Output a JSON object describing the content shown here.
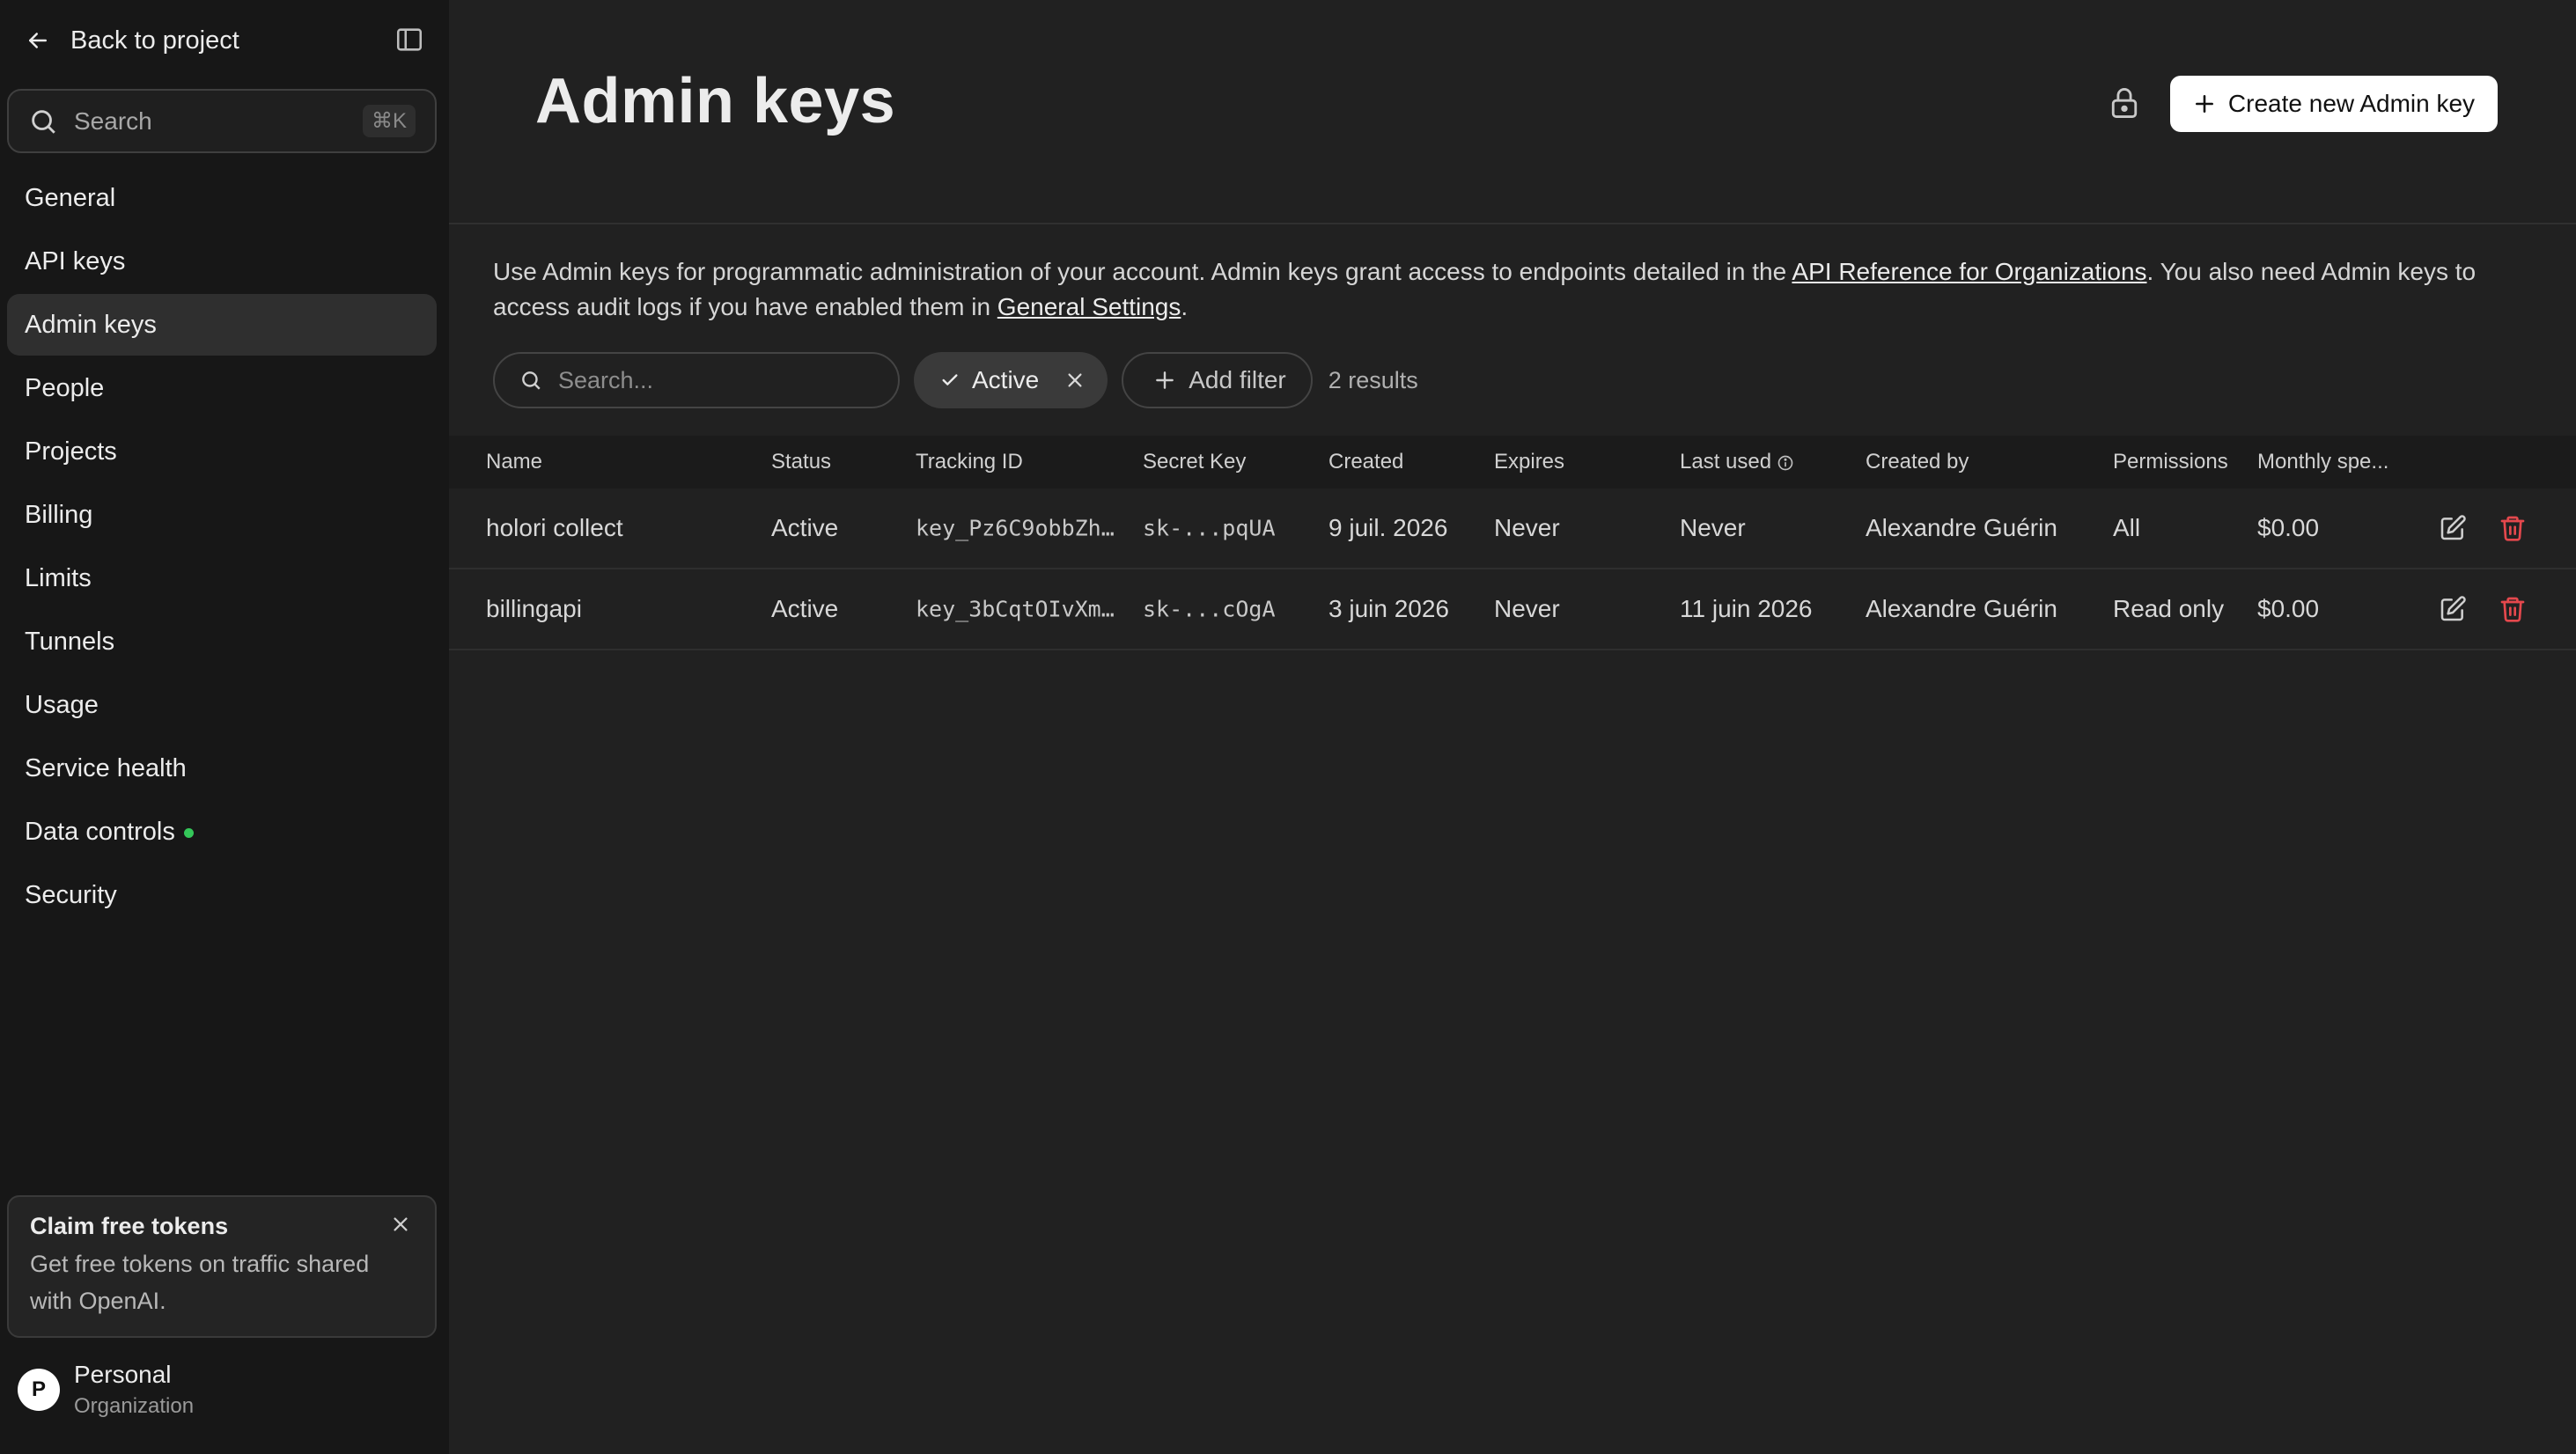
{
  "sidebar": {
    "back_label": "Back to project",
    "search_placeholder": "Search",
    "search_shortcut": "⌘K",
    "nav": [
      {
        "label": "General"
      },
      {
        "label": "API keys"
      },
      {
        "label": "Admin keys",
        "active": true
      },
      {
        "label": "People"
      },
      {
        "label": "Projects"
      },
      {
        "label": "Billing"
      },
      {
        "label": "Limits"
      },
      {
        "label": "Tunnels"
      },
      {
        "label": "Usage"
      },
      {
        "label": "Service health"
      },
      {
        "label": "Data controls",
        "indicator": "green-dot"
      },
      {
        "label": "Security"
      }
    ],
    "promo": {
      "title": "Claim free tokens",
      "body": "Get free tokens on traffic shared with OpenAI."
    },
    "org": {
      "avatar_letter": "P",
      "name": "Personal",
      "type": "Organization"
    }
  },
  "header": {
    "title": "Admin keys",
    "create_label": "Create new Admin key"
  },
  "description": {
    "part1": "Use Admin keys for programmatic administration of your account. Admin keys grant access to endpoints detailed in the ",
    "link1": "API Reference for Organizations",
    "part2": ". You also need Admin keys to access audit logs if you have enabled them in ",
    "link2": "General Settings",
    "part3": "."
  },
  "filters": {
    "search_placeholder": "Search...",
    "active_chip": "Active",
    "add_filter": "Add filter",
    "results": "2 results"
  },
  "table": {
    "columns": [
      "Name",
      "Status",
      "Tracking ID",
      "Secret Key",
      "Created",
      "Expires",
      "Last used",
      "Created by",
      "Permissions",
      "Monthly spe..."
    ],
    "rows": [
      [
        "holori collect",
        "Active",
        "key_Pz6C9obbZh…",
        "sk-...pqUA",
        "9 juil. 2026",
        "Never",
        "Never",
        "Alexandre Guérin",
        "All",
        "$0.00"
      ],
      [
        "billingapi",
        "Active",
        "key_3bCqtOIvXm…",
        "sk-...cOgA",
        "3 juin 2026",
        "Never",
        "11 juin 2026",
        "Alexandre Guérin",
        "Read only",
        "$0.00"
      ]
    ]
  },
  "colors": {
    "delete": "#e5484d",
    "accent_dot": "#34c759",
    "background": "#212121",
    "sidebar": "#171717"
  }
}
